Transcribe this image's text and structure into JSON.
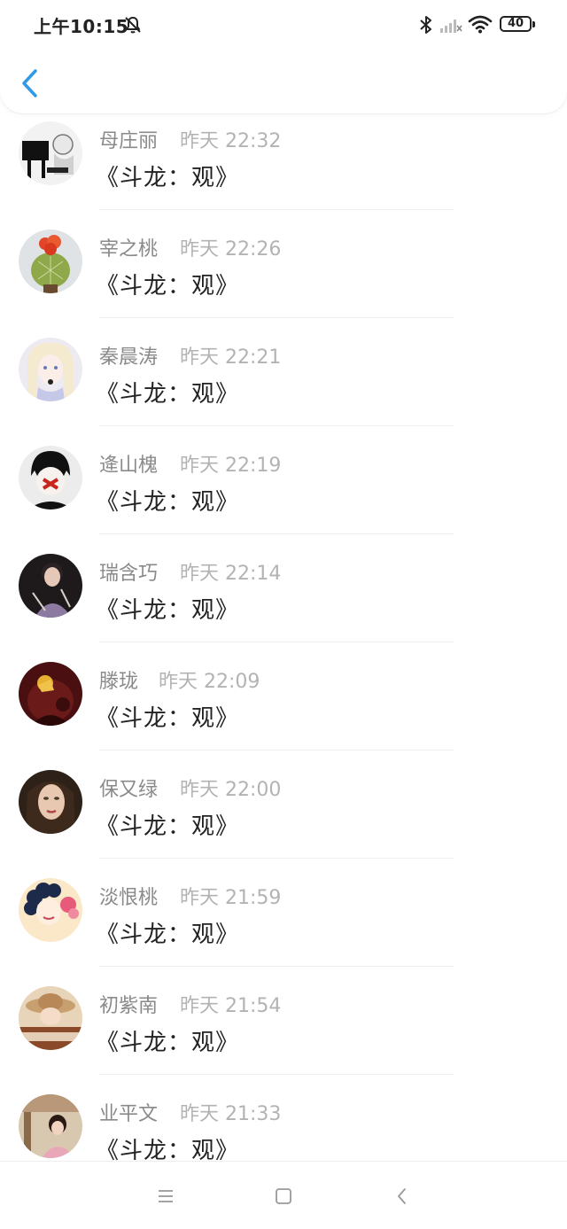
{
  "status_bar": {
    "time": "上午10:15",
    "battery": "40",
    "icons": [
      "bell-muted-icon",
      "bluetooth-icon",
      "signal-icon",
      "wifi-icon",
      "battery-icon"
    ]
  },
  "header": {
    "back_icon": "chevron-left-icon"
  },
  "comments": [
    {
      "name": "母庄丽",
      "time": "昨天 22:32",
      "message": "《斗龙：观》"
    },
    {
      "name": "宰之桃",
      "time": "昨天 22:26",
      "message": "《斗龙：观》"
    },
    {
      "name": "秦晨涛",
      "time": "昨天 22:21",
      "message": "《斗龙：观》"
    },
    {
      "name": "逄山槐",
      "time": "昨天 22:19",
      "message": "《斗龙：观》"
    },
    {
      "name": "瑞含巧",
      "time": "昨天 22:14",
      "message": "《斗龙：观》"
    },
    {
      "name": "滕珑",
      "time": "昨天 22:09",
      "message": "《斗龙：观》"
    },
    {
      "name": "保又绿",
      "time": "昨天 22:00",
      "message": "《斗龙：观》"
    },
    {
      "name": "淡恨桃",
      "time": "昨天 21:59",
      "message": "《斗龙：观》"
    },
    {
      "name": "初紫南",
      "time": "昨天 21:54",
      "message": "《斗龙：观》"
    },
    {
      "name": "业平文",
      "time": "昨天 21:33",
      "message": "《斗龙：观》"
    }
  ],
  "nav_bar": {
    "icons": [
      "menu-icon",
      "home-icon",
      "back-icon"
    ]
  },
  "colors": {
    "accent": "#2f9be8",
    "name_text": "#8a8a8a",
    "time_text": "#b3b3b3",
    "message_text": "#222222"
  }
}
